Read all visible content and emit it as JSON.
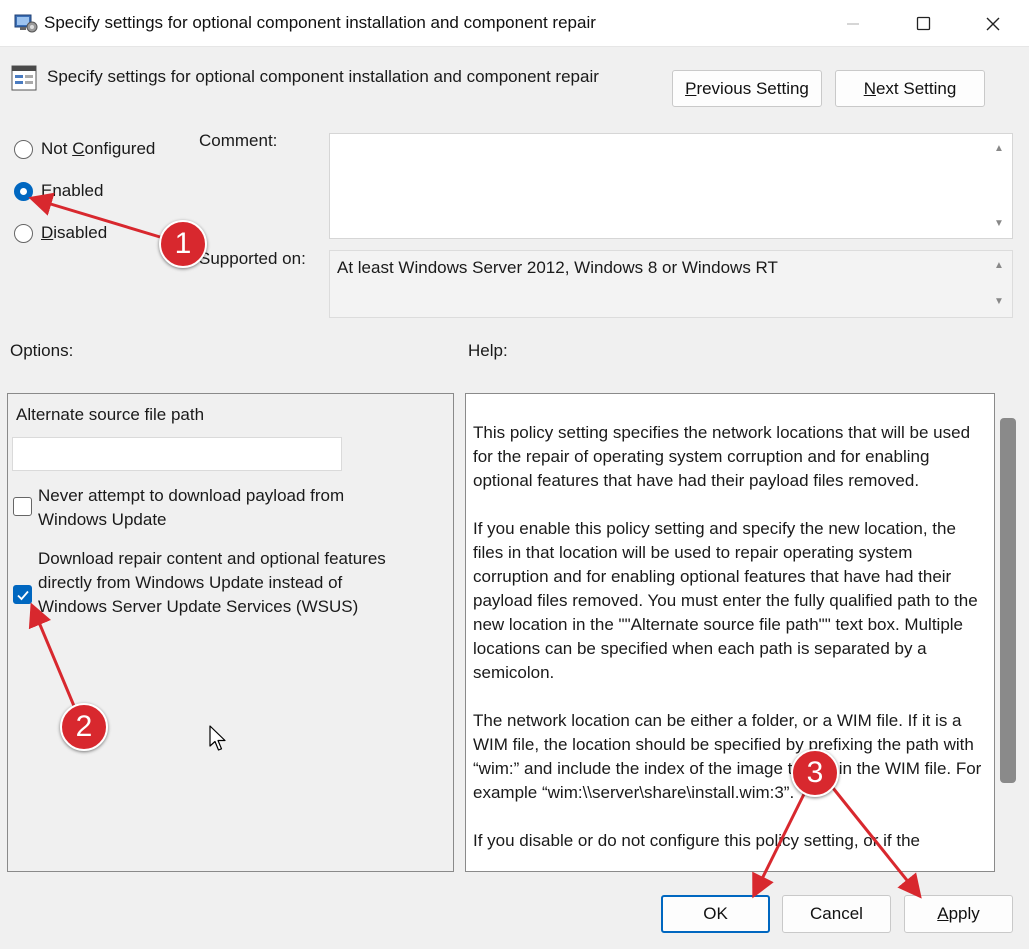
{
  "window": {
    "title": "Specify settings for optional component installation and component repair",
    "minimize_glyph": "─",
    "maximize_glyph": "☐",
    "close_glyph": "✕"
  },
  "header": {
    "policy_title": "Specify settings for optional component installation and component repair",
    "prev_button": {
      "pre": "",
      "key": "P",
      "post": "revious Setting"
    },
    "next_button": {
      "pre": "",
      "key": "N",
      "post": "ext Setting"
    }
  },
  "state": {
    "radios": [
      {
        "pre": "Not ",
        "key": "C",
        "post": "onfigured",
        "checked": false
      },
      {
        "pre": "",
        "key": "E",
        "post": "nabled",
        "checked": true
      },
      {
        "pre": "",
        "key": "D",
        "post": "isabled",
        "checked": false
      }
    ]
  },
  "comment": {
    "label": "Comment:",
    "value": ""
  },
  "supported": {
    "label": "Supported on:",
    "value": "At least Windows Server 2012, Windows 8 or Windows RT"
  },
  "options": {
    "label": "Options:",
    "alt_path_label": "Alternate source file path",
    "alt_path_value": "",
    "checkboxes": [
      {
        "label": "Never attempt to download payload from Windows Update",
        "checked": false
      },
      {
        "label": "Download repair content and optional features directly from Windows Update instead of Windows Server Update Services (WSUS)",
        "checked": true
      }
    ]
  },
  "help": {
    "label": "Help:",
    "paragraphs": [
      "This policy setting specifies the network locations that will be used for the repair of operating system corruption and for enabling optional features that have had their payload files removed.",
      "If you enable this policy setting and specify the new location, the files in that location will be used to repair operating system corruption and for enabling optional features that have had their payload files removed. You must enter the fully qualified path to the new location in the \"\"Alternate source file path\"\" text box. Multiple locations can be specified when each path is separated by a semicolon.",
      "The network location can be either a folder, or a WIM file. If it is a WIM file, the location should be specified by prefixing the path with “wim:” and include the index of the image to use in the WIM file. For example “wim:\\\\server\\share\\install.wim:3”.",
      "If you disable or do not configure this policy setting, or if the"
    ]
  },
  "footer": {
    "ok": "OK",
    "cancel": "Cancel",
    "apply": {
      "pre": "",
      "key": "A",
      "post": "pply"
    }
  },
  "annotations": {
    "badge1": "1",
    "badge2": "2",
    "badge3": "3",
    "color": "#d8282e"
  },
  "colors": {
    "accent": "#0067c0",
    "annotation": "#d8282e"
  }
}
